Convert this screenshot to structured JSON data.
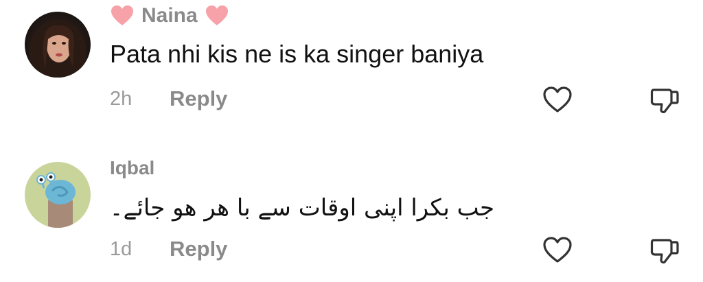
{
  "comments": [
    {
      "username": "Naina",
      "text": "Pata nhi kis ne is ka singer baniya",
      "time": "2h",
      "reply_label": "Reply",
      "avatar": "woman-portrait-avatar",
      "username_decoration": "pink-heart-emoji"
    },
    {
      "username": "Iqbal",
      "text": "جب بکرا اپنی اوقات سے با ھر ھو جائے۔",
      "time": "1d",
      "reply_label": "Reply",
      "avatar": "cartoon-snail-avatar"
    }
  ],
  "icons": {
    "like": "heart-outline-icon",
    "dislike": "thumbs-down-icon"
  },
  "colors": {
    "heart_emoji": "#f7a1a8",
    "meta_text": "#8a8a8a",
    "comment_text": "#111111",
    "icon_stroke": "#333333"
  }
}
